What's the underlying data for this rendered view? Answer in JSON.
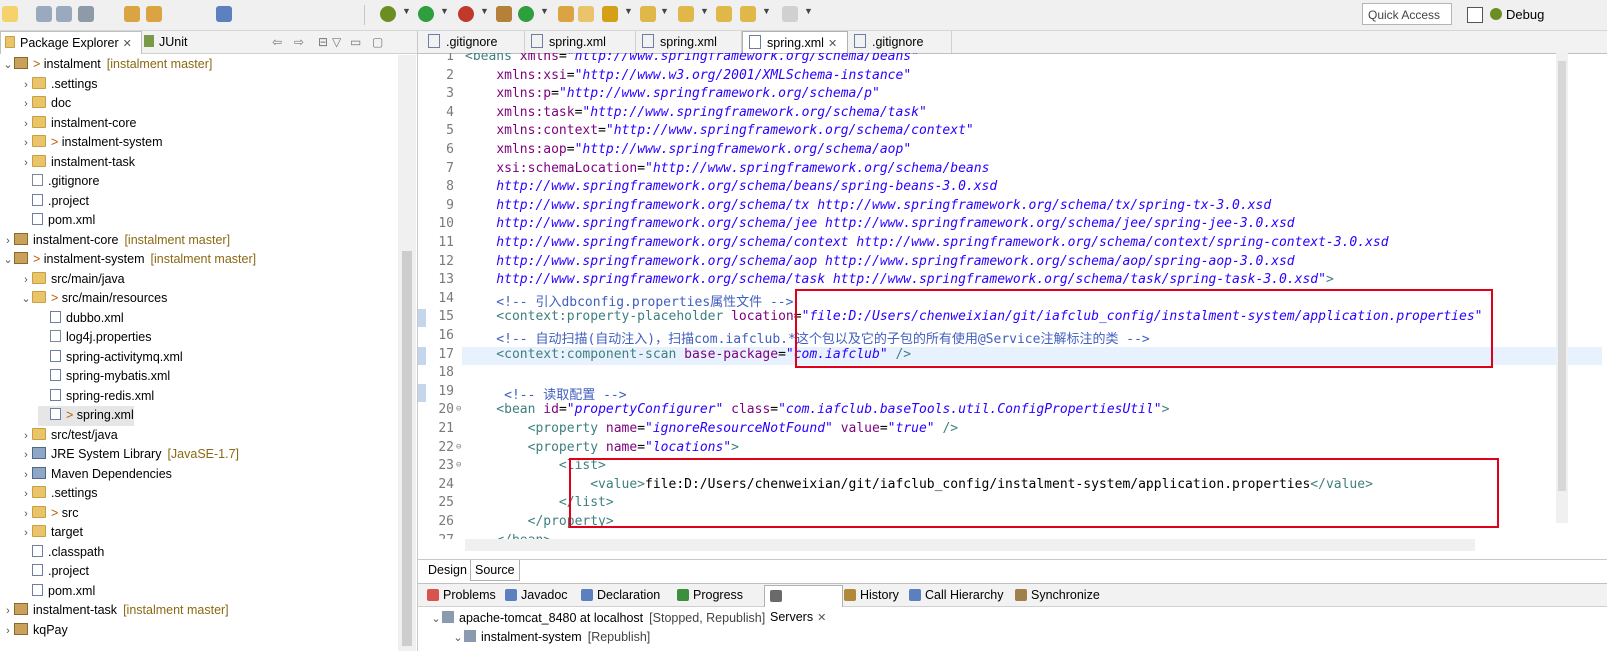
{
  "toolbar": {
    "quick_access_placeholder": "Quick Access",
    "perspective_label": "Debug"
  },
  "left_panel": {
    "tabs": [
      {
        "label": "Package Explorer"
      },
      {
        "label": "JUnit"
      }
    ],
    "tree": [
      {
        "indent": 0,
        "chev": "⌄",
        "icon": "proj",
        "prefix": "> ",
        "label": "instalment",
        "tag": "[instalment master]"
      },
      {
        "indent": 1,
        "chev": "›",
        "icon": "folder",
        "prefix": "",
        "label": ".settings",
        "tag": ""
      },
      {
        "indent": 1,
        "chev": "›",
        "icon": "folder",
        "prefix": "",
        "label": "doc",
        "tag": ""
      },
      {
        "indent": 1,
        "chev": "›",
        "icon": "folder",
        "prefix": "",
        "label": "instalment-core",
        "tag": ""
      },
      {
        "indent": 1,
        "chev": "›",
        "icon": "folder",
        "prefix": "> ",
        "label": "instalment-system",
        "tag": ""
      },
      {
        "indent": 1,
        "chev": "›",
        "icon": "folder",
        "prefix": "",
        "label": "instalment-task",
        "tag": ""
      },
      {
        "indent": 1,
        "chev": "",
        "icon": "file",
        "prefix": "",
        "label": ".gitignore",
        "tag": ""
      },
      {
        "indent": 1,
        "chev": "",
        "icon": "xfile",
        "prefix": "",
        "label": ".project",
        "tag": ""
      },
      {
        "indent": 1,
        "chev": "",
        "icon": "xfile",
        "prefix": "",
        "label": "pom.xml",
        "tag": ""
      },
      {
        "indent": 0,
        "chev": "›",
        "icon": "proj",
        "prefix": "",
        "label": "instalment-core",
        "tag": "[instalment master]"
      },
      {
        "indent": 0,
        "chev": "⌄",
        "icon": "proj",
        "prefix": "> ",
        "label": "instalment-system",
        "tag": "[instalment master]"
      },
      {
        "indent": 1,
        "chev": "›",
        "icon": "folder",
        "prefix": "",
        "label": "src/main/java",
        "tag": ""
      },
      {
        "indent": 1,
        "chev": "⌄",
        "icon": "folder",
        "prefix": "> ",
        "label": "src/main/resources",
        "tag": ""
      },
      {
        "indent": 2,
        "chev": "",
        "icon": "xfile",
        "prefix": "",
        "label": "dubbo.xml",
        "tag": ""
      },
      {
        "indent": 2,
        "chev": "",
        "icon": "file",
        "prefix": "",
        "label": "log4j.properties",
        "tag": ""
      },
      {
        "indent": 2,
        "chev": "",
        "icon": "xfile",
        "prefix": "",
        "label": "spring-activitymq.xml",
        "tag": ""
      },
      {
        "indent": 2,
        "chev": "",
        "icon": "xfile",
        "prefix": "",
        "label": "spring-mybatis.xml",
        "tag": ""
      },
      {
        "indent": 2,
        "chev": "",
        "icon": "xfile",
        "prefix": "",
        "label": "spring-redis.xml",
        "tag": ""
      },
      {
        "indent": 2,
        "chev": "",
        "icon": "xfile",
        "prefix": "> ",
        "label": "spring.xml",
        "tag": "",
        "selected": true
      },
      {
        "indent": 1,
        "chev": "›",
        "icon": "folder",
        "prefix": "",
        "label": "src/test/java",
        "tag": ""
      },
      {
        "indent": 1,
        "chev": "›",
        "icon": "lib",
        "prefix": "",
        "label": "JRE System Library",
        "tag": "[JavaSE-1.7]"
      },
      {
        "indent": 1,
        "chev": "›",
        "icon": "lib",
        "prefix": "",
        "label": "Maven Dependencies",
        "tag": ""
      },
      {
        "indent": 1,
        "chev": "›",
        "icon": "folder",
        "prefix": "",
        "label": ".settings",
        "tag": ""
      },
      {
        "indent": 1,
        "chev": "›",
        "icon": "folder",
        "prefix": "> ",
        "label": "src",
        "tag": ""
      },
      {
        "indent": 1,
        "chev": "›",
        "icon": "folder",
        "prefix": "",
        "label": "target",
        "tag": ""
      },
      {
        "indent": 1,
        "chev": "",
        "icon": "xfile",
        "prefix": "",
        "label": ".classpath",
        "tag": ""
      },
      {
        "indent": 1,
        "chev": "",
        "icon": "xfile",
        "prefix": "",
        "label": ".project",
        "tag": ""
      },
      {
        "indent": 1,
        "chev": "",
        "icon": "xfile",
        "prefix": "",
        "label": "pom.xml",
        "tag": ""
      },
      {
        "indent": 0,
        "chev": "›",
        "icon": "proj",
        "prefix": "",
        "label": "instalment-task",
        "tag": "[instalment master]"
      },
      {
        "indent": 0,
        "chev": "›",
        "icon": "proj",
        "prefix": "",
        "label": "kqPay",
        "tag": ""
      }
    ]
  },
  "editor": {
    "tabs": [
      {
        "label": ".gitignore",
        "active": false,
        "closable": false
      },
      {
        "label": "spring.xml",
        "active": false,
        "closable": false
      },
      {
        "label": "spring.xml",
        "active": false,
        "closable": false
      },
      {
        "label": "spring.xml",
        "active": true,
        "closable": true
      },
      {
        "label": ".gitignore",
        "active": false,
        "closable": false
      }
    ],
    "lines": [
      {
        "n": "1",
        "fold": "",
        "segs": [
          [
            "t",
            "<beans "
          ],
          [
            "a",
            "xmlns"
          ],
          [
            "p",
            "="
          ],
          [
            "v",
            "\"http://www.springframework.org/schema/beans\""
          ]
        ]
      },
      {
        "n": "2",
        "fold": "",
        "segs": [
          [
            "p",
            "    "
          ],
          [
            "a",
            "xmlns:xsi"
          ],
          [
            "p",
            "="
          ],
          [
            "v",
            "\"http://www.w3.org/2001/XMLSchema-instance\""
          ]
        ]
      },
      {
        "n": "3",
        "fold": "",
        "segs": [
          [
            "p",
            "    "
          ],
          [
            "a",
            "xmlns:p"
          ],
          [
            "p",
            "="
          ],
          [
            "v",
            "\"http://www.springframework.org/schema/p\""
          ]
        ]
      },
      {
        "n": "4",
        "fold": "",
        "segs": [
          [
            "p",
            "    "
          ],
          [
            "a",
            "xmlns:task"
          ],
          [
            "p",
            "="
          ],
          [
            "v",
            "\"http://www.springframework.org/schema/task\""
          ]
        ]
      },
      {
        "n": "5",
        "fold": "",
        "segs": [
          [
            "p",
            "    "
          ],
          [
            "a",
            "xmlns:context"
          ],
          [
            "p",
            "="
          ],
          [
            "v",
            "\"http://www.springframework.org/schema/context\""
          ]
        ]
      },
      {
        "n": "6",
        "fold": "",
        "segs": [
          [
            "p",
            "    "
          ],
          [
            "a",
            "xmlns:aop"
          ],
          [
            "p",
            "="
          ],
          [
            "v",
            "\"http://www.springframework.org/schema/aop\""
          ]
        ]
      },
      {
        "n": "7",
        "fold": "",
        "segs": [
          [
            "p",
            "    "
          ],
          [
            "a",
            "xsi:schemaLocation"
          ],
          [
            "p",
            "="
          ],
          [
            "v",
            "\"http://www.springframework.org/schema/beans"
          ]
        ]
      },
      {
        "n": "8",
        "fold": "",
        "segs": [
          [
            "v",
            "    http://www.springframework.org/schema/beans/spring-beans-3.0.xsd"
          ]
        ]
      },
      {
        "n": "9",
        "fold": "",
        "segs": [
          [
            "v",
            "    http://www.springframework.org/schema/tx http://www.springframework.org/schema/tx/spring-tx-3.0.xsd"
          ]
        ]
      },
      {
        "n": "10",
        "fold": "",
        "segs": [
          [
            "v",
            "    http://www.springframework.org/schema/jee http://www.springframework.org/schema/jee/spring-jee-3.0.xsd"
          ]
        ]
      },
      {
        "n": "11",
        "fold": "",
        "segs": [
          [
            "v",
            "    http://www.springframework.org/schema/context http://www.springframework.org/schema/context/spring-context-3.0.xsd"
          ]
        ]
      },
      {
        "n": "12",
        "fold": "",
        "segs": [
          [
            "v",
            "    http://www.springframework.org/schema/aop http://www.springframework.org/schema/aop/spring-aop-3.0.xsd"
          ]
        ]
      },
      {
        "n": "13",
        "fold": "",
        "segs": [
          [
            "v",
            "    http://www.springframework.org/schema/task http://www.springframework.org/schema/task/spring-task-3.0.xsd\""
          ],
          [
            "t",
            ">"
          ]
        ]
      },
      {
        "n": "14",
        "fold": "",
        "segs": [
          [
            "c",
            "    <!-- 引入dbconfig.properties属性文件 -->"
          ]
        ]
      },
      {
        "n": "15",
        "fold": "",
        "segs": [
          [
            "t",
            "    <context:property-placeholder "
          ],
          [
            "a",
            "location"
          ],
          [
            "p",
            "="
          ],
          [
            "v",
            "\"file:D:/Users/chenweixian/git/iafclub_config/instalment-system/application.properties\""
          ]
        ]
      },
      {
        "n": "16",
        "fold": "",
        "segs": [
          [
            "c",
            "    <!-- 自动扫描(自动注入)，扫描com.iafclub.*这个包以及它的子包的所有使用@Service注解标注的类 -->"
          ]
        ]
      },
      {
        "n": "17",
        "fold": "",
        "segs": [
          [
            "t",
            "    <context:component-scan "
          ],
          [
            "a",
            "base-package"
          ],
          [
            "p",
            "="
          ],
          [
            "v",
            "\"com.iafclub\""
          ],
          [
            "t",
            " />"
          ]
        ]
      },
      {
        "n": "18",
        "fold": "",
        "segs": []
      },
      {
        "n": "19",
        "fold": "",
        "segs": [
          [
            "c",
            "     <!-- 读取配置 -->"
          ]
        ]
      },
      {
        "n": "20",
        "fold": "⊖",
        "segs": [
          [
            "t",
            "    <bean "
          ],
          [
            "a",
            "id"
          ],
          [
            "p",
            "="
          ],
          [
            "v",
            "\"propertyConfigurer\""
          ],
          [
            "p",
            " "
          ],
          [
            "a",
            "class"
          ],
          [
            "p",
            "="
          ],
          [
            "v",
            "\"com.iafclub.baseTools.util.ConfigPropertiesUtil\""
          ],
          [
            "t",
            ">"
          ]
        ]
      },
      {
        "n": "21",
        "fold": "",
        "segs": [
          [
            "t",
            "        <property "
          ],
          [
            "a",
            "name"
          ],
          [
            "p",
            "="
          ],
          [
            "v",
            "\"ignoreResourceNotFound\""
          ],
          [
            "p",
            " "
          ],
          [
            "a",
            "value"
          ],
          [
            "p",
            "="
          ],
          [
            "v",
            "\"true\""
          ],
          [
            "t",
            " />"
          ]
        ]
      },
      {
        "n": "22",
        "fold": "⊖",
        "segs": [
          [
            "t",
            "        <property "
          ],
          [
            "a",
            "name"
          ],
          [
            "p",
            "="
          ],
          [
            "v",
            "\"locations\""
          ],
          [
            "t",
            ">"
          ]
        ]
      },
      {
        "n": "23",
        "fold": "⊖",
        "segs": [
          [
            "t",
            "            <list>"
          ]
        ]
      },
      {
        "n": "24",
        "fold": "",
        "segs": [
          [
            "t",
            "                <value>"
          ],
          [
            "p",
            "file:D:/Users/chenweixian/git/iafclub_config/instalment-system/application.properties"
          ],
          [
            "t",
            "</value>"
          ]
        ]
      },
      {
        "n": "25",
        "fold": "",
        "segs": [
          [
            "t",
            "            </list>"
          ]
        ]
      },
      {
        "n": "26",
        "fold": "",
        "segs": [
          [
            "t",
            "        </property>"
          ]
        ]
      },
      {
        "n": "27",
        "fold": "",
        "segs": [
          [
            "t",
            "    </bean>"
          ]
        ]
      }
    ],
    "design_tab": "Design",
    "source_tab": "Source"
  },
  "bottom_panel": {
    "tabs": [
      {
        "label": "Problems",
        "color": "#d9534f"
      },
      {
        "label": "Javadoc",
        "color": "#5b7fbf"
      },
      {
        "label": "Declaration",
        "color": "#5b7fbf"
      },
      {
        "label": "Progress",
        "color": "#3c8f3c"
      },
      {
        "label": "Servers",
        "color": "#6a6a6a",
        "active": true
      },
      {
        "label": "History",
        "color": "#b08a3a"
      },
      {
        "label": "Call Hierarchy",
        "color": "#5b7fbf"
      },
      {
        "label": "Synchronize",
        "color": "#a0804a"
      }
    ],
    "servers": [
      {
        "label": "apache-tomcat_8480 at localhost",
        "status": "[Stopped, Republish]"
      },
      {
        "label": "instalment-system",
        "status": "[Republish]"
      }
    ]
  },
  "colors": {
    "tag": "#8b6914",
    "highlight_box": "#e0001a",
    "xml_tag": "#3f7f7f",
    "xml_attr": "#7f007f",
    "xml_value": "#2a00ff",
    "xml_comment": "#3f5fbf"
  }
}
